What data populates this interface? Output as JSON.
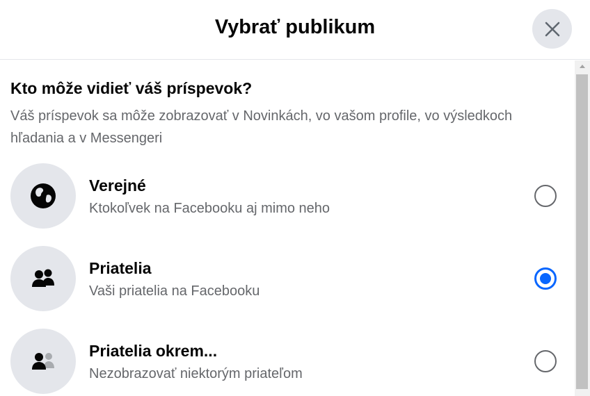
{
  "dialog": {
    "title": "Vybrať publikum",
    "close_icon": "close-icon"
  },
  "section": {
    "title": "Kto môže vidieť váš príspevok?",
    "subtitle": "Váš príspevok sa môže zobrazovať v Novinkách, vo vašom profile, vo výsledkoch hľadania a v Messengeri"
  },
  "options": [
    {
      "icon": "globe-icon",
      "label": "Verejné",
      "description": "Ktokoľvek na Facebooku aj mimo neho",
      "selected": false
    },
    {
      "icon": "friends-icon",
      "label": "Priatelia",
      "description": "Vaši priatelia na Facebooku",
      "selected": true
    },
    {
      "icon": "friends-except-icon",
      "label": "Priatelia okrem...",
      "description": "Nezobrazovať niektorým priateľom",
      "selected": false
    }
  ],
  "colors": {
    "accent": "#0866ff",
    "icon_bg": "#e4e6eb",
    "secondary_text": "#65676b",
    "primary_text": "#050505"
  }
}
